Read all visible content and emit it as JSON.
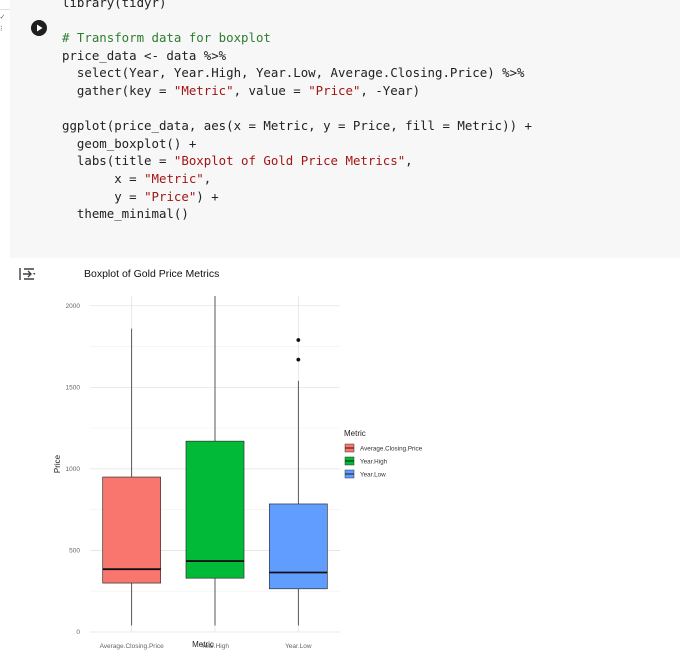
{
  "notebook": {
    "code_lines": [
      {
        "segments": [
          {
            "t": "library(tidyr)",
            "c": ""
          }
        ]
      },
      {
        "segments": [
          {
            "t": "",
            "c": ""
          }
        ]
      },
      {
        "segments": [
          {
            "t": "# Transform data for boxplot",
            "c": "c-comment"
          }
        ]
      },
      {
        "segments": [
          {
            "t": "price_data <- data %>%",
            "c": ""
          }
        ]
      },
      {
        "segments": [
          {
            "t": "  select(Year, Year.High, Year.Low, Average.Closing.Price) %>%",
            "c": ""
          }
        ]
      },
      {
        "segments": [
          {
            "t": "  gather(key = ",
            "c": ""
          },
          {
            "t": "\"Metric\"",
            "c": "c-str"
          },
          {
            "t": ", value = ",
            "c": ""
          },
          {
            "t": "\"Price\"",
            "c": "c-str"
          },
          {
            "t": ", -Year)",
            "c": ""
          }
        ]
      },
      {
        "segments": [
          {
            "t": "",
            "c": ""
          }
        ]
      },
      {
        "segments": [
          {
            "t": "ggplot(price_data, aes(x = Metric, y = Price, fill = Metric)) +",
            "c": ""
          }
        ]
      },
      {
        "segments": [
          {
            "t": "  geom_boxplot() +",
            "c": ""
          }
        ]
      },
      {
        "segments": [
          {
            "t": "  labs(title = ",
            "c": ""
          },
          {
            "t": "\"Boxplot of Gold Price Metrics\"",
            "c": "c-str"
          },
          {
            "t": ",",
            "c": ""
          }
        ]
      },
      {
        "segments": [
          {
            "t": "       x = ",
            "c": ""
          },
          {
            "t": "\"Metric\"",
            "c": "c-str"
          },
          {
            "t": ",",
            "c": ""
          }
        ]
      },
      {
        "segments": [
          {
            "t": "       y = ",
            "c": ""
          },
          {
            "t": "\"Price\"",
            "c": "c-str"
          },
          {
            "t": ") +",
            "c": ""
          }
        ]
      },
      {
        "segments": [
          {
            "t": "  theme_minimal()",
            "c": ""
          }
        ]
      }
    ]
  },
  "chart_data": {
    "type": "boxplot",
    "title": "Boxplot of Gold Price Metrics",
    "xlabel": "Metric",
    "ylabel": "Price",
    "ylim": [
      0,
      2060
    ],
    "yticks": [
      0,
      500,
      1000,
      1500,
      2000
    ],
    "grid": true,
    "categories": [
      "Average.Closing.Price",
      "Year.High",
      "Year.Low"
    ],
    "boxes": [
      {
        "name": "Average.Closing.Price",
        "min": 40,
        "q1": 300,
        "median": 385,
        "q3": 950,
        "max": 1860,
        "outliers": [],
        "color": "#f8766d"
      },
      {
        "name": "Year.High",
        "min": 40,
        "q1": 330,
        "median": 435,
        "q3": 1170,
        "max": 2060,
        "outliers": [],
        "color": "#00ba38"
      },
      {
        "name": "Year.Low",
        "min": 40,
        "q1": 265,
        "median": 365,
        "q3": 785,
        "max": 1540,
        "outliers": [
          1670,
          1790
        ],
        "color": "#619cff"
      }
    ],
    "legend": {
      "title": "Metric",
      "position": "right"
    }
  }
}
